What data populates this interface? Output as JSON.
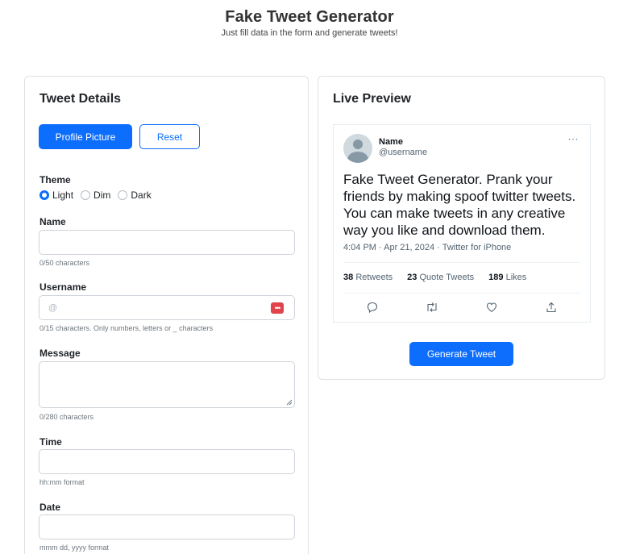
{
  "header": {
    "title": "Fake Tweet Generator",
    "subtitle": "Just fill data in the form and generate tweets!"
  },
  "form": {
    "title": "Tweet Details",
    "profile_picture_label": "Profile Picture",
    "reset_label": "Reset",
    "theme": {
      "label": "Theme",
      "options": [
        "Light",
        "Dim",
        "Dark"
      ],
      "selected": "Light"
    },
    "name": {
      "label": "Name",
      "value": "",
      "help": "0/50 characters"
    },
    "username": {
      "label": "Username",
      "placeholder": "@",
      "value": "",
      "help": "0/15 characters. Only numbers, letters or _ characters"
    },
    "message": {
      "label": "Message",
      "value": "",
      "help": "0/280 characters"
    },
    "time": {
      "label": "Time",
      "value": "",
      "help": "hh:mm format"
    },
    "date": {
      "label": "Date",
      "value": "",
      "help": "mmm dd, yyyy format"
    }
  },
  "preview": {
    "title": "Live Preview",
    "tweet": {
      "name": "Name",
      "username": "@username",
      "more": "···",
      "message": "Fake Tweet Generator. Prank your friends by making spoof twitter tweets. You can make tweets in any creative way you like and download them.",
      "meta": "4:04 PM · Apr 21, 2024 · Twitter for iPhone",
      "retweets_count": "38",
      "retweets_label": "Retweets",
      "quotes_count": "23",
      "quotes_label": "Quote Tweets",
      "likes_count": "189",
      "likes_label": "Likes",
      "icons": [
        "reply-icon",
        "retweet-icon",
        "like-icon",
        "share-icon"
      ]
    },
    "generate_label": "Generate Tweet"
  },
  "colors": {
    "primary": "#0d6efd",
    "password_icon": "#e0454b"
  }
}
